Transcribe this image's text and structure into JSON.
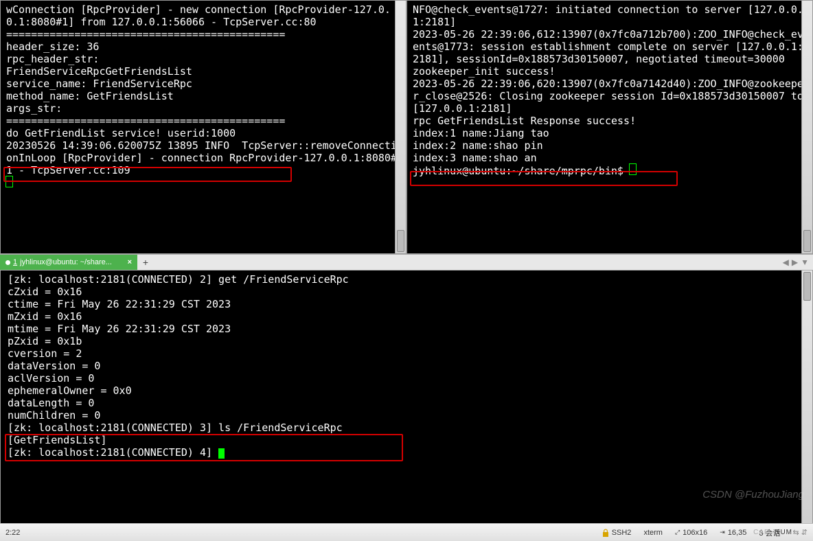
{
  "pane_left": {
    "lines": [
      "wConnection [RpcProvider] - new connection [RpcProvider-127.0.0.1:8080#1] from 127.0.0.1:56066 - TcpServer.cc:80",
      "=============================================",
      "header_size: 36",
      "rpc_header_str:",
      "FriendServiceRpcGetFriendsList",
      "service_name: FriendServiceRpc",
      "method_name: GetFriendsList",
      "args_str:",
      "=============================================",
      "do GetFriendList service! userid:1000",
      "20230526 14:39:06.620075Z 13895 INFO  TcpServer::removeConnectionInLoop [RpcProvider] - connection RpcProvider-127.0.0.1:8080#1 - TcpServer.cc:109"
    ]
  },
  "pane_right": {
    "lines": [
      "NFO@check_events@1727: initiated connection to server [127.0.0.1:2181]",
      "2023-05-26 22:39:06,612:13907(0x7fc0a712b700):ZOO_INFO@check_events@1773: session establishment complete on server [127.0.0.1:2181], sessionId=0x188573d30150007, negotiated timeout=30000",
      "zookeeper_init success!",
      "2023-05-26 22:39:06,620:13907(0x7fc0a7142d40):ZOO_INFO@zookeeper_close@2526: Closing zookeeper session Id=0x188573d30150007 to [127.0.0.1:2181]",
      "",
      "rpc GetFriendsList Response success!",
      "index:1 name:Jiang tao",
      "index:2 name:shao pin",
      "index:3 name:shao an"
    ],
    "prompt": "jyhlinux@ubuntu:~/share/mprpc/bin$ "
  },
  "tab": {
    "number": "1",
    "title": "jyhlinux@ubuntu: ~/share...",
    "close": "×",
    "add": "+"
  },
  "bottom": {
    "lines": [
      "[zk: localhost:2181(CONNECTED) 2] get /FriendServiceRpc",
      "",
      "cZxid = 0x16",
      "ctime = Fri May 26 22:31:29 CST 2023",
      "mZxid = 0x16",
      "mtime = Fri May 26 22:31:29 CST 2023",
      "pZxid = 0x1b",
      "cversion = 2",
      "dataVersion = 0",
      "aclVersion = 0",
      "ephemeralOwner = 0x0",
      "dataLength = 0",
      "numChildren = 0",
      "[zk: localhost:2181(CONNECTED) 3] ls /FriendServiceRpc",
      "[GetFriendsList]",
      "[zk: localhost:2181(CONNECTED) 4] "
    ]
  },
  "statusbar": {
    "left": "2:22",
    "ssh": "SSH2",
    "term": "xterm",
    "size": "106x16",
    "sel": "16,35",
    "sessions": "3 会话",
    "cap": "CAP",
    "num": "NUM"
  },
  "watermark": "CSDN @FuzhouJiang",
  "nav": {
    "left": "◀",
    "right": "▶",
    "down": "▼"
  }
}
